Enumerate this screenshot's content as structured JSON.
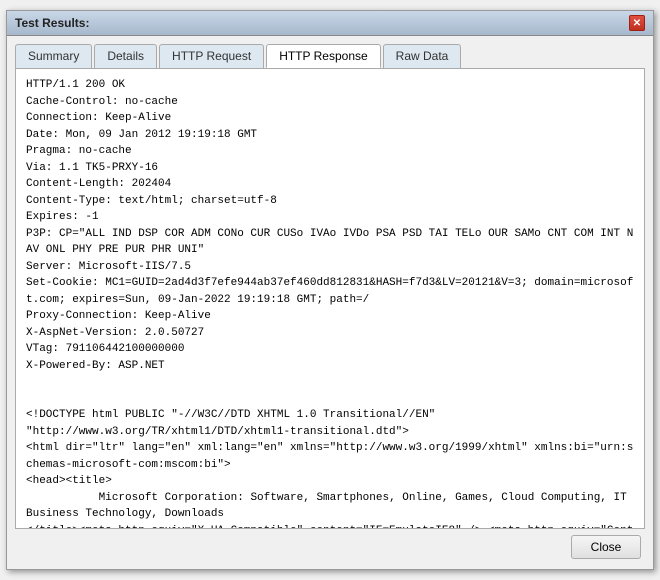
{
  "window": {
    "title": "Test Results:",
    "close_icon": "✕"
  },
  "tabs": [
    {
      "label": "Summary",
      "active": false
    },
    {
      "label": "Details",
      "active": false
    },
    {
      "label": "HTTP Request",
      "active": false
    },
    {
      "label": "HTTP Response",
      "active": true
    },
    {
      "label": "Raw Data",
      "active": false
    }
  ],
  "content": {
    "text": "HTTP/1.1 200 OK\nCache-Control: no-cache\nConnection: Keep-Alive\nDate: Mon, 09 Jan 2012 19:19:18 GMT\nPragma: no-cache\nVia: 1.1 TK5-PRXY-16\nContent-Length: 202404\nContent-Type: text/html; charset=utf-8\nExpires: -1\nP3P: CP=\"ALL IND DSP COR ADM CONo CUR CUSo IVAo IVDo PSA PSD TAI TELo OUR SAMo CNT COM INT NAV ONL PHY PRE PUR PHR UNI\"\nServer: Microsoft-IIS/7.5\nSet-Cookie: MC1=GUID=2ad4d3f7efe944ab37ef460dd812831&HASH=f7d3&LV=20121&V=3; domain=microsoft.com; expires=Sun, 09-Jan-2022 19:19:18 GMT; path=/\nProxy-Connection: Keep-Alive\nX-AspNet-Version: 2.0.50727\nVTag: 791106442100000000\nX-Powered-By: ASP.NET\n\n\n<!DOCTYPE html PUBLIC \"-//W3C//DTD XHTML 1.0 Transitional//EN\"\n\"http://www.w3.org/TR/xhtml1/DTD/xhtml1-transitional.dtd\">\n<html dir=\"ltr\" lang=\"en\" xml:lang=\"en\" xmlns=\"http://www.w3.org/1999/xhtml\" xmlns:bi=\"urn:schemas-microsoft-com:mscom:bi\">\n<head><title>\n           Microsoft Corporation: Software, Smartphones, Online, Games, Cloud Computing, IT Business Technology, Downloads\n</title><meta http-equiv=\"X-UA-Compatible\" content=\"IE=EmulateIE8\" /> <meta http-equiv=\"Content-Type\" content=\"text/html; charset=utf-8\" />\n<script type=\"text/javascript\">\nvar QosInitTime = (new Date()).getTime();\nvar QosLoadTime = '';\nvar QosPageUri = encodeURI(window.location);"
  },
  "buttons": {
    "close_label": "Close"
  }
}
